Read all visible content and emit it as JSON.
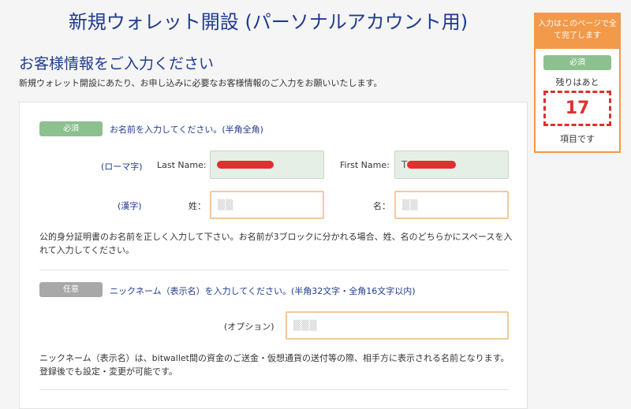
{
  "page": {
    "title": "新規ウォレット開設 (パーソナルアカウント用)",
    "section_title": "お客様情報をご入力ください",
    "section_desc": "新規ウォレット開設にあたり、お申し込みに必要なお客様情報のご入力をお願いいたします。"
  },
  "name_block": {
    "badge": "必須",
    "question": "お名前を入力してください。(半角全角)",
    "roman_label": "(ローマ字)",
    "last_name_label": "Last Name:",
    "first_name_label": "First Name:",
    "first_name_initial": "T",
    "kanji_label": "(漢字)",
    "sei_label": "姓：",
    "mei_label": "名：",
    "note": "公的身分証明書のお名前を正しく入力して下さい。お名前が3ブロックに分かれる場合、姓、名のどちらかにスペースを入れて入力してください。"
  },
  "nickname_block": {
    "badge": "任意",
    "question": "ニックネーム（表示名）を入力してください。(半角32文字・全角16文字以内)",
    "option_label": "(オプション)",
    "note": "ニックネーム（表示名）は、bitwallet間の資金のご送金・仮想通貨の送付等の際、相手方に表示される名前となります。登録後でも設定・変更が可能です。"
  },
  "side_panel": {
    "header": "入力はこのページで全て完了します",
    "badge": "必須",
    "remaining_label": "残りはあと",
    "count": "17",
    "unit": "項目です"
  },
  "colors": {
    "title_blue": "#1f3b8f",
    "required_green": "#8cc08f",
    "optional_gray": "#a8a8a8",
    "accent_orange": "#f2994a",
    "alert_red": "#e0302f"
  }
}
